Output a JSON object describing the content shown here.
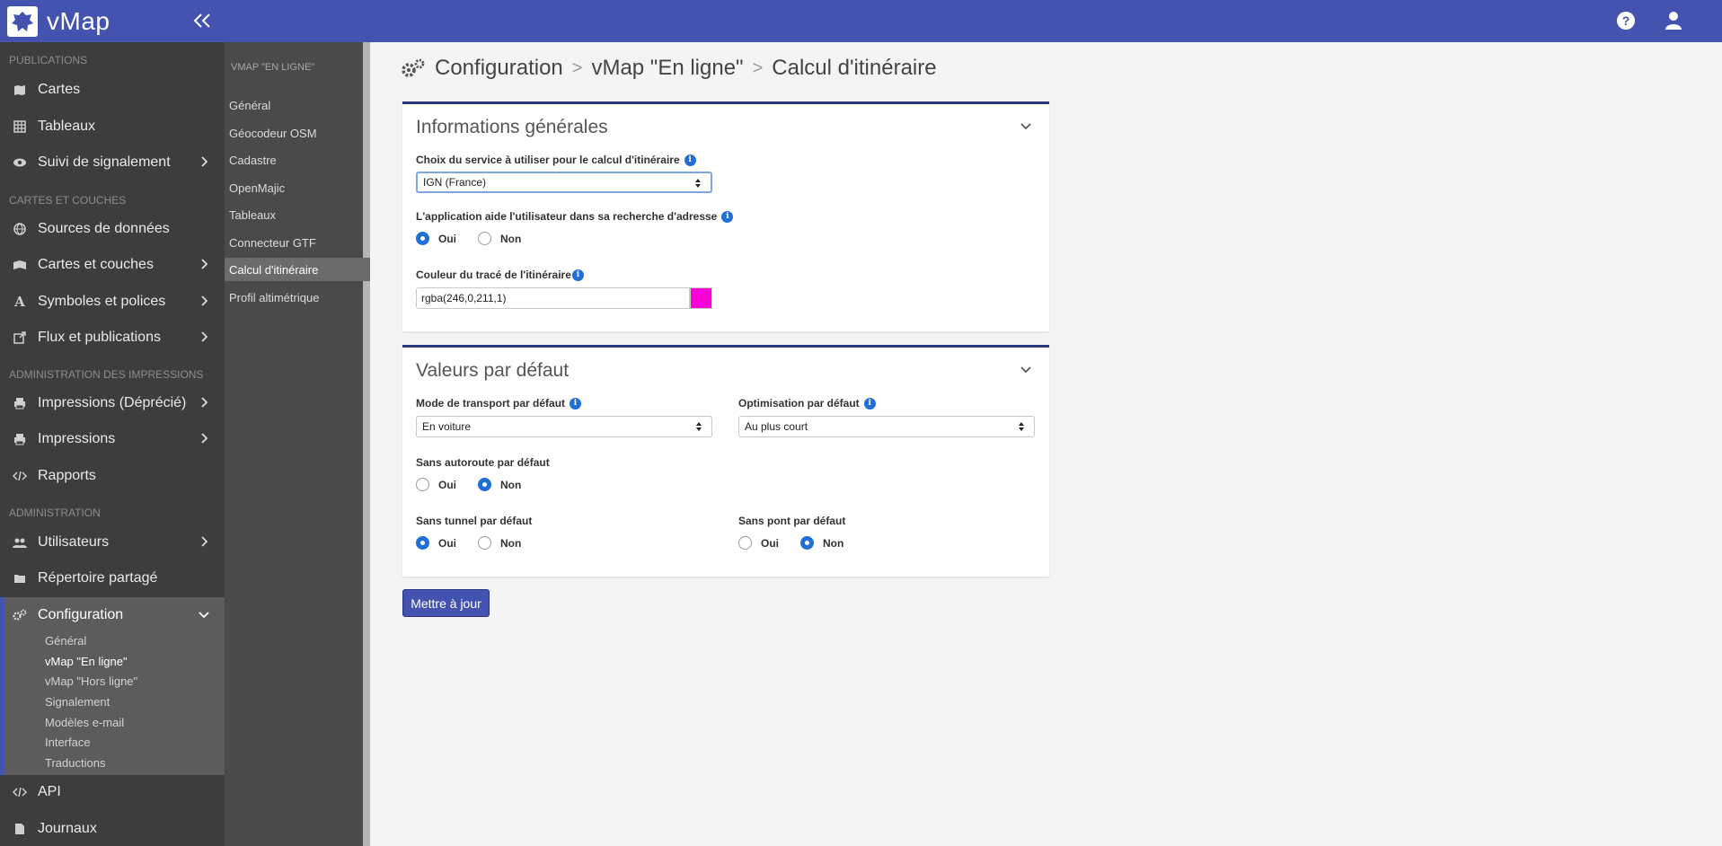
{
  "brand": {
    "name": "vMap"
  },
  "colors": {
    "accent": "#4453b0",
    "route_color": "#f600d3"
  },
  "sidebar": {
    "sections": [
      {
        "label": "PUBLICATIONS"
      },
      {
        "label": "CARTES ET COUCHES"
      },
      {
        "label": "ADMINISTRATION DES IMPRESSIONS"
      },
      {
        "label": "ADMINISTRATION"
      }
    ],
    "items": [
      {
        "label": "Cartes",
        "icon": "map-icon"
      },
      {
        "label": "Tableaux",
        "icon": "table-icon"
      },
      {
        "label": "Suivi de signalement",
        "icon": "eye-icon"
      },
      {
        "label": "Sources de données",
        "icon": "globe-icon"
      },
      {
        "label": "Cartes et couches",
        "icon": "layers-icon"
      },
      {
        "label": "Symboles et polices",
        "icon": "font-icon"
      },
      {
        "label": "Flux et publications",
        "icon": "external-link-icon"
      },
      {
        "label": "Impressions (Déprécié)",
        "icon": "print-icon"
      },
      {
        "label": "Impressions",
        "icon": "print-icon"
      },
      {
        "label": "Rapports",
        "icon": "code-icon"
      },
      {
        "label": "Utilisateurs",
        "icon": "users-icon"
      },
      {
        "label": "Répertoire partagé",
        "icon": "folder-icon"
      },
      {
        "label": "Configuration",
        "icon": "cogs-icon"
      },
      {
        "label": "API",
        "icon": "code-icon"
      },
      {
        "label": "Journaux",
        "icon": "file-icon"
      }
    ],
    "config_sub": [
      {
        "label": "Général"
      },
      {
        "label": "vMap \"En ligne\""
      },
      {
        "label": "vMap \"Hors ligne\""
      },
      {
        "label": "Signalement"
      },
      {
        "label": "Modèles e-mail"
      },
      {
        "label": "Interface"
      },
      {
        "label": "Traductions"
      }
    ]
  },
  "sidebar2": {
    "heading": "VMAP \"EN LIGNE\"",
    "items": [
      {
        "label": "Général"
      },
      {
        "label": "Géocodeur OSM"
      },
      {
        "label": "Cadastre"
      },
      {
        "label": "OpenMajic"
      },
      {
        "label": "Tableaux"
      },
      {
        "label": "Connecteur GTF"
      },
      {
        "label": "Calcul d'itinéraire"
      },
      {
        "label": "Profil altimétrique"
      }
    ]
  },
  "breadcrumb": {
    "part1": "Configuration",
    "part2": "vMap \"En ligne\"",
    "part3": "Calcul d'itinéraire",
    "separator": ">"
  },
  "general_panel": {
    "title": "Informations générales",
    "service_label": "Choix du service à utiliser pour le calcul d'itinéraire",
    "service_value": "IGN (France)",
    "address_help_label": "L'application aide l'utilisateur dans sa recherche d'adresse",
    "yes": "Oui",
    "no": "Non",
    "color_label": "Couleur du tracé de l'itinéraire",
    "color_value": "rgba(246,0,211,1)"
  },
  "defaults_panel": {
    "title": "Valeurs par défaut",
    "transport_label": "Mode de transport par défaut",
    "transport_value": "En voiture",
    "optim_label": "Optimisation par défaut",
    "optim_value": "Au plus court",
    "no_highway_label": "Sans autoroute par défaut",
    "no_tunnel_label": "Sans tunnel par défaut",
    "no_bridge_label": "Sans pont par défaut",
    "yes": "Oui",
    "no": "Non"
  },
  "submit_label": "Mettre à jour"
}
